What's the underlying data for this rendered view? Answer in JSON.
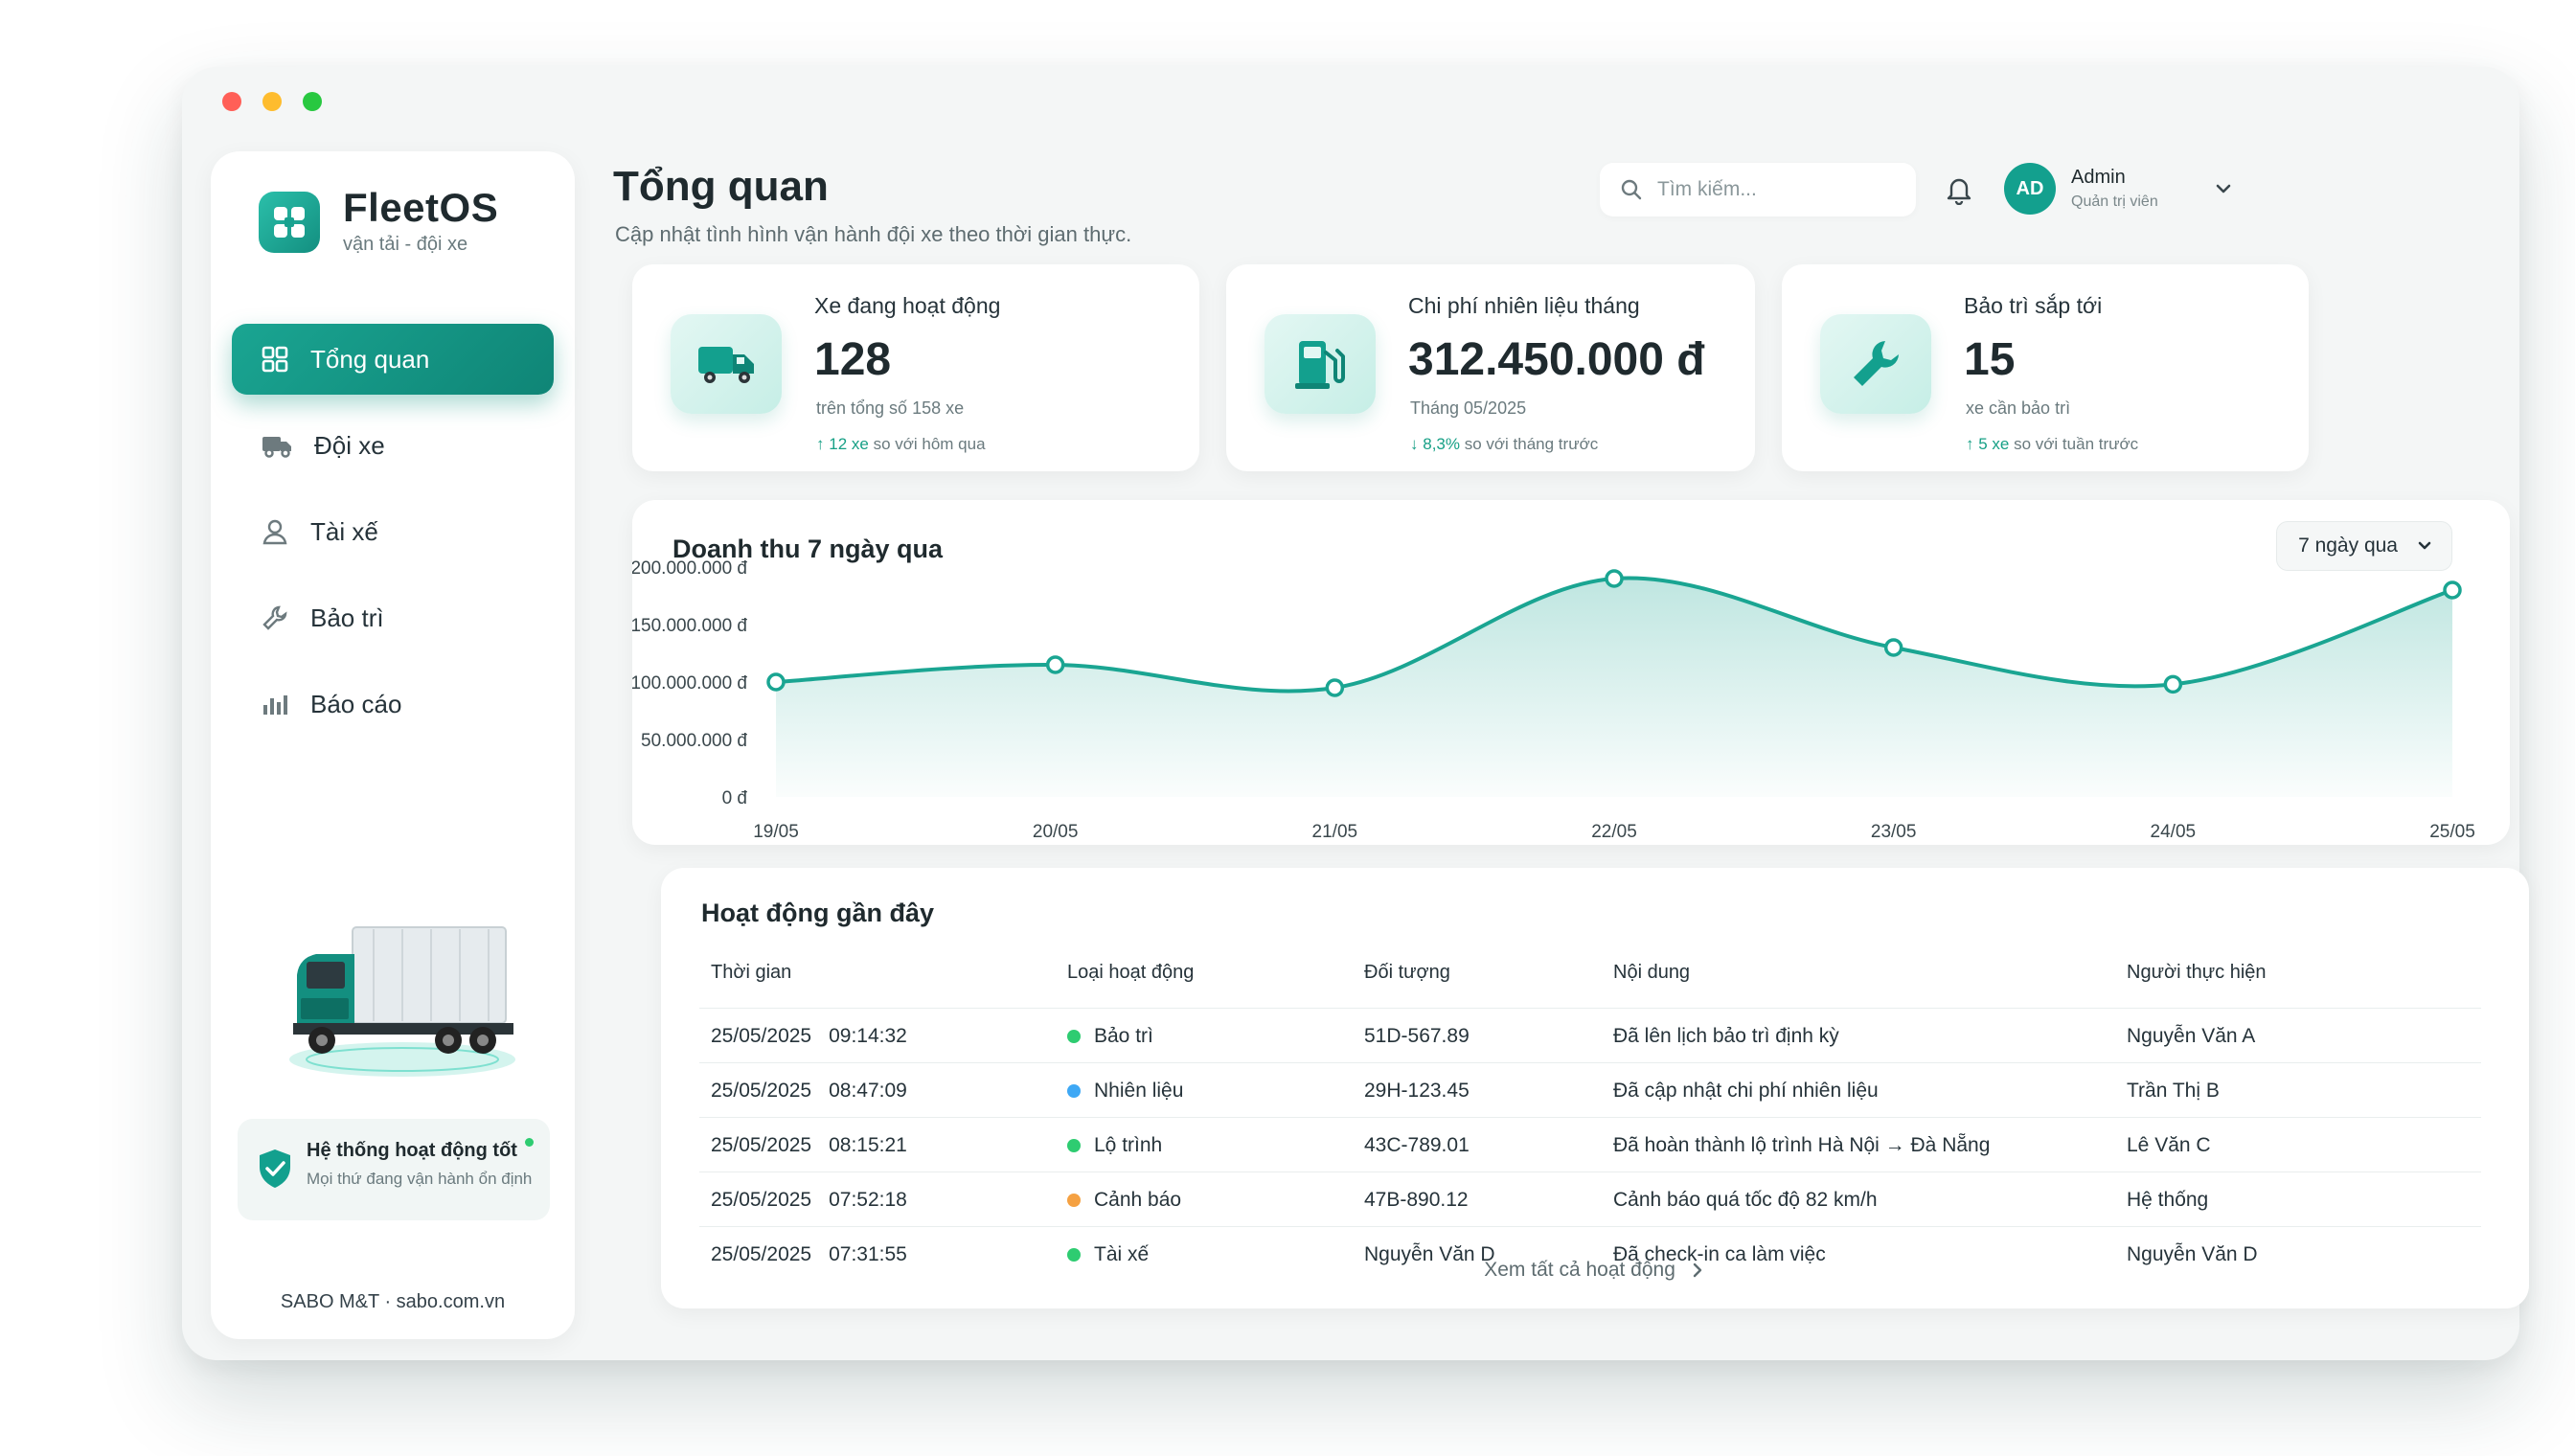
{
  "window": {
    "controls": [
      "close",
      "minimize",
      "maximize"
    ]
  },
  "brand": {
    "name": "FleetOS",
    "tagline": "vận tải - đội xe",
    "accent": "#13a08e"
  },
  "sidebar": {
    "items": [
      {
        "label": "Tổng quan",
        "icon": "grid-icon",
        "active": true
      },
      {
        "label": "Đội xe",
        "icon": "truck-icon",
        "active": false
      },
      {
        "label": "Tài xế",
        "icon": "user-icon",
        "active": false
      },
      {
        "label": "Bảo trì",
        "icon": "wrench-icon",
        "active": false
      },
      {
        "label": "Báo cáo",
        "icon": "bar-chart-icon",
        "active": false
      }
    ],
    "status": {
      "title": "Hệ thống hoạt động tốt",
      "subtitle": "Mọi thứ đang vận hành ổn định",
      "color": "#2ecc71"
    },
    "footer": "SABO M&T · sabo.com.vn"
  },
  "header": {
    "title": "Tổng quan",
    "subtitle": "Cập nhật tình hình vận hành đội xe theo thời gian thực.",
    "search_placeholder": "Tìm kiếm...",
    "user": {
      "initials": "AD",
      "name": "Admin",
      "role": "Quản trị viên"
    }
  },
  "stats": [
    {
      "label": "Xe đang hoạt động",
      "value": "128",
      "hint": "trên tổng số 158 xe",
      "delta_value": "12 xe",
      "delta_text": "so với hôm qua",
      "delta_dir": "up",
      "icon": "truck-icon"
    },
    {
      "label": "Chi phí nhiên liệu tháng",
      "value": "312.450.000 đ",
      "hint": "Tháng 05/2025",
      "delta_value": "8,3%",
      "delta_text": "so với tháng trước",
      "delta_dir": "down",
      "icon": "fuel-pump-icon"
    },
    {
      "label": "Bảo trì sắp tới",
      "value": "15",
      "hint": "xe cần bảo trì",
      "delta_value": "5 xe",
      "delta_text": "so với tuần trước",
      "delta_dir": "up",
      "icon": "wrench-icon"
    }
  ],
  "chart": {
    "title": "Doanh thu 7 ngày qua",
    "range_label": "7 ngày qua"
  },
  "chart_data": {
    "type": "area",
    "title": "Doanh thu 7 ngày qua",
    "x": [
      "19/05",
      "20/05",
      "21/05",
      "22/05",
      "23/05",
      "24/05",
      "25/05"
    ],
    "y_ticks": [
      "200.000.000 đ",
      "150.000.000 đ",
      "100.000.000 đ",
      "50.000.000 đ",
      "0 đ"
    ],
    "ylim": [
      0,
      200000000
    ],
    "series": [
      {
        "values": [
          100000000,
          115000000,
          95000000,
          190000000,
          130000000,
          98000000,
          180000000
        ],
        "color": "#1aa592"
      }
    ],
    "grid": false
  },
  "activity": {
    "title": "Hoạt động gần đây",
    "columns": [
      "Thời gian",
      "Loại hoạt động",
      "Đối tượng",
      "Nội dung",
      "Người thực hiện"
    ],
    "rows": [
      {
        "date": "25/05/2025",
        "time": "09:14:32",
        "type": "Bảo trì",
        "type_color": "#2ecc71",
        "target": "51D-567.89",
        "content": "Đã lên lịch bảo trì định kỳ",
        "actor": "Nguyễn Văn A"
      },
      {
        "date": "25/05/2025",
        "time": "08:47:09",
        "type": "Nhiên liệu",
        "type_color": "#3ea8f5",
        "target": "29H-123.45",
        "content": "Đã cập nhật chi phí nhiên liệu",
        "actor": "Trần Thị B"
      },
      {
        "date": "25/05/2025",
        "time": "08:15:21",
        "type": "Lộ trình",
        "type_color": "#2ecc71",
        "target": "43C-789.01",
        "content": "Đã hoàn thành lộ trình Hà Nội → Đà Nẵng",
        "actor": "Lê Văn C"
      },
      {
        "date": "25/05/2025",
        "time": "07:52:18",
        "type": "Cảnh báo",
        "type_color": "#f5a142",
        "target": "47B-890.12",
        "content": "Cảnh báo quá tốc độ 82 km/h",
        "actor": "Hệ thống"
      },
      {
        "date": "25/05/2025",
        "time": "07:31:55",
        "type": "Tài xế",
        "type_color": "#2ecc71",
        "target": "Nguyễn Văn D",
        "content": "Đã check-in ca làm việc",
        "actor": "Nguyễn Văn D"
      }
    ],
    "view_all": "Xem tất cả hoạt động"
  }
}
